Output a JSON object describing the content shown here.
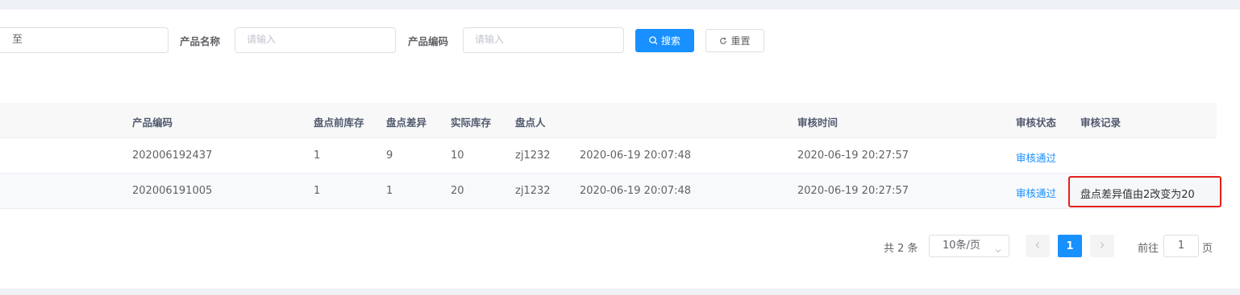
{
  "filters": {
    "date_separator": "至",
    "product_name_label": "产品名称",
    "product_name_placeholder": "请输入",
    "product_code_label": "产品编码",
    "product_code_placeholder": "请输入",
    "search_label": "搜索",
    "reset_label": "重置"
  },
  "table": {
    "columns": {
      "product_code": "产品编码",
      "stock_before": "盘点前库存",
      "difference": "盘点差异",
      "actual_stock": "实际库存",
      "checker": "盘点人",
      "review_time": "审核时间",
      "review_status": "审核状态",
      "review_record": "审核记录"
    },
    "rows": [
      {
        "product_code": "202006192437",
        "stock_before": "1",
        "difference": "9",
        "actual_stock": "10",
        "checker": "zj1232",
        "check_time": "2020-06-19 20:07:48",
        "review_time": "2020-06-19 20:27:57",
        "review_status": "审核通过",
        "review_record": ""
      },
      {
        "product_code": "202006191005",
        "stock_before": "1",
        "difference": "1",
        "actual_stock": "20",
        "checker": "zj1232",
        "check_time": "2020-06-19 20:07:48",
        "review_time": "2020-06-19 20:27:57",
        "review_status": "审核通过",
        "review_record": "盘点差异值由2改变为20"
      }
    ]
  },
  "pagination": {
    "total": "共 2 条",
    "page_size": "10条/页",
    "current_page": "1",
    "goto_prefix": "前往",
    "goto_value": "1",
    "goto_suffix": "页"
  },
  "colors": {
    "primary": "#1890ff",
    "highlight_border": "#e4201b"
  }
}
